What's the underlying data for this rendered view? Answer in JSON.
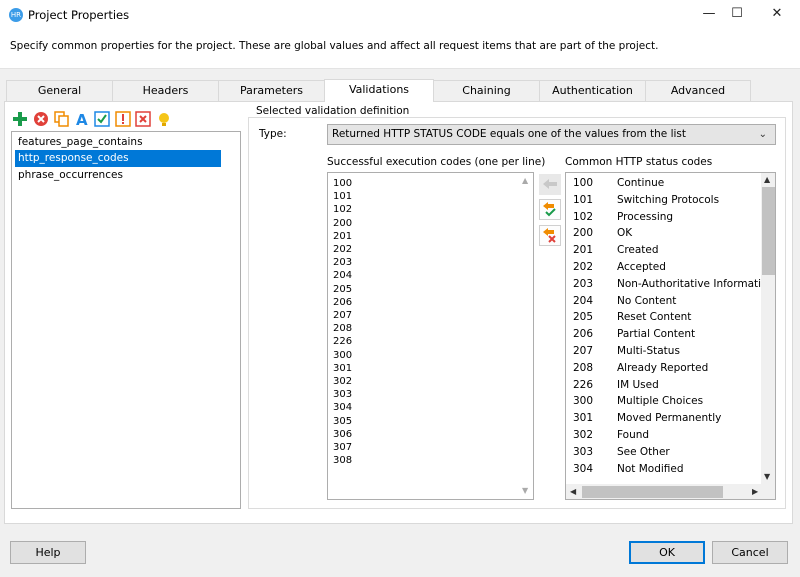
{
  "window": {
    "title": "Project Properties",
    "app_icon_text": "HR",
    "minimize_glyph": "—",
    "maximize_glyph": "☐",
    "close_glyph": "✕"
  },
  "description": "Specify common properties for the project. These are global values and affect all request items that are part of the project.",
  "tabs": [
    {
      "label": "General"
    },
    {
      "label": "Headers"
    },
    {
      "label": "Parameters"
    },
    {
      "label": "Validations",
      "active": true
    },
    {
      "label": "Chaining"
    },
    {
      "label": "Authentication"
    },
    {
      "label": "Advanced"
    }
  ],
  "toolbar": {
    "icons": [
      "add-icon",
      "delete-icon",
      "copy-icon",
      "rename-icon",
      "check-icon",
      "warning-icon",
      "remove-icon",
      "lightbulb-icon"
    ],
    "colors": {
      "add": "#1a9b4b",
      "delete": "#e0413a",
      "copy": "#f08c00",
      "rename": "#1e88e5",
      "check": "#1e88e5",
      "warning": "#e0413a",
      "remove": "#e0413a",
      "lightbulb": "#f5c518"
    }
  },
  "validations_list": {
    "items": [
      "features_page_contains",
      "http_response_codes",
      "phrase_occurrences"
    ],
    "selected_index": 1
  },
  "definition": {
    "group_label": "Selected validation definition",
    "type_label": "Type:",
    "type_value": "Returned HTTP STATUS CODE equals one of the values from the list",
    "successful_label": "Successful execution codes (one per line)",
    "successful_codes": [
      "100",
      "101",
      "102",
      "200",
      "201",
      "202",
      "203",
      "204",
      "205",
      "206",
      "207",
      "208",
      "226",
      "300",
      "301",
      "302",
      "303",
      "304",
      "305",
      "306",
      "307",
      "308"
    ],
    "common_label": "Common HTTP status codes",
    "common_codes": [
      {
        "code": "100",
        "name": "Continue"
      },
      {
        "code": "101",
        "name": "Switching Protocols"
      },
      {
        "code": "102",
        "name": "Processing"
      },
      {
        "code": "200",
        "name": "OK"
      },
      {
        "code": "201",
        "name": "Created"
      },
      {
        "code": "202",
        "name": "Accepted"
      },
      {
        "code": "203",
        "name": "Non-Authoritative Information"
      },
      {
        "code": "204",
        "name": "No Content"
      },
      {
        "code": "205",
        "name": "Reset Content"
      },
      {
        "code": "206",
        "name": "Partial Content"
      },
      {
        "code": "207",
        "name": "Multi-Status"
      },
      {
        "code": "208",
        "name": "Already Reported"
      },
      {
        "code": "226",
        "name": "IM Used"
      },
      {
        "code": "300",
        "name": "Multiple Choices"
      },
      {
        "code": "301",
        "name": "Moved Permanently"
      },
      {
        "code": "302",
        "name": "Found"
      },
      {
        "code": "303",
        "name": "See Other"
      },
      {
        "code": "304",
        "name": "Not Modified"
      }
    ]
  },
  "buttons": {
    "help": "Help",
    "ok": "OK",
    "cancel": "Cancel"
  }
}
